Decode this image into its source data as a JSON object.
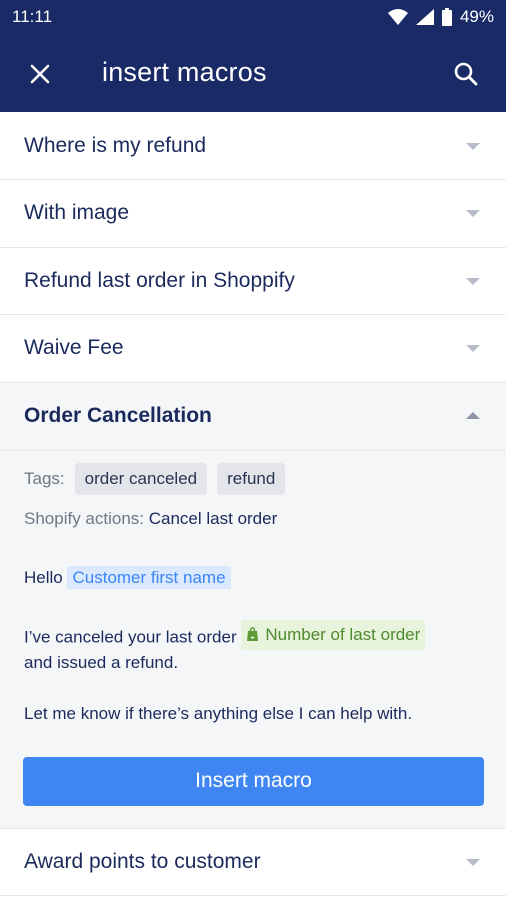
{
  "status": {
    "time": "11:11",
    "battery": "49%"
  },
  "app_bar": {
    "title": "insert macros",
    "close_icon": "close-icon",
    "search_icon": "search-icon"
  },
  "macros": [
    {
      "label": "Where is my refund"
    },
    {
      "label": "With image"
    },
    {
      "label": "Refund last order in Shoppify"
    },
    {
      "label": "Waive Fee"
    }
  ],
  "expanded": {
    "label": "Order Cancellation",
    "tags_label": "Tags:",
    "tags": [
      "order canceled",
      "refund"
    ],
    "shopify_label": "Shopify actions:",
    "shopify_value": "Cancel last order",
    "greeting": "Hello",
    "var_customer": "Customer first name",
    "line2_before": "I’ve canceled your last order",
    "var_order": "Number of last order",
    "line2_after": "and issued a refund.",
    "line3": "Let me know if there’s anything else I can help with.",
    "button": "Insert macro"
  },
  "after": [
    {
      "label": "Award points to customer"
    }
  ],
  "colors": {
    "header": "#1a2a66",
    "accent": "#3f86f3",
    "text": "#1b2a5c"
  }
}
